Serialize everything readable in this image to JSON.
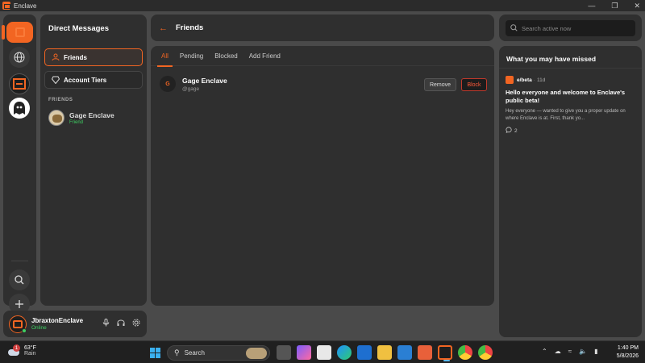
{
  "window": {
    "title": "Enclave"
  },
  "sidebar": {
    "dm_title": "Direct Messages",
    "nav": [
      {
        "label": "Friends",
        "icon": "user-icon"
      },
      {
        "label": "Account Tiers",
        "icon": "diamond-icon"
      }
    ],
    "section_label": "FRIENDS",
    "friends": [
      {
        "name": "Gage Enclave",
        "status": "Friend"
      }
    ]
  },
  "header": {
    "title": "Friends",
    "back_icon": "arrow-left-icon"
  },
  "tabs": [
    "All",
    "Pending",
    "Blocked",
    "Add Friend"
  ],
  "active_tab": "All",
  "friend_rows": [
    {
      "name": "Gage Enclave",
      "handle": "@gage",
      "initial": "G",
      "remove_label": "Remove",
      "block_label": "Block"
    }
  ],
  "search": {
    "placeholder": "Search active now"
  },
  "missed": {
    "title": "What you may have missed",
    "post": {
      "community": "e/beta",
      "age": "11d",
      "title": "Hello everyone and welcome to Enclave's public beta!",
      "body": "Hey everyone — wanted to give you a proper update on where Enclave is at. First, thank yo...",
      "comments": "2"
    }
  },
  "user": {
    "name": "JbraxtonEnclave",
    "status": "Online"
  },
  "taskbar": {
    "weather_temp": "63°F",
    "weather_cond": "Rain",
    "weather_badge": "1",
    "search_label": "Search",
    "time": "1:40 PM",
    "date": "5/8/2026"
  },
  "colors": {
    "accent": "#f26522",
    "online": "#3ecf62",
    "danger": "#c0392b"
  }
}
